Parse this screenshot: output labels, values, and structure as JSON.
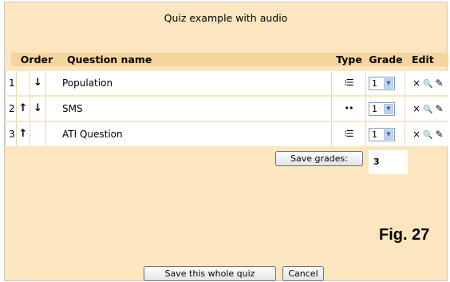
{
  "title": "Quiz example with audio",
  "table": {
    "headers": {
      "order": "Order",
      "question_name": "Question name",
      "type": "Type",
      "grade": "Grade",
      "edit": "Edit"
    },
    "rows": [
      {
        "num": "1",
        "up": "",
        "down": "↓",
        "name": "Population",
        "type_icon": "multichoice-icon",
        "type_glyph": "⁝☰",
        "grade": "1"
      },
      {
        "num": "2",
        "up": "↑",
        "down": "↓",
        "name": "SMS",
        "type_icon": "short-answer-icon",
        "type_glyph": "••",
        "grade": "1"
      },
      {
        "num": "3",
        "up": "↑",
        "down": "",
        "name": "ATI Question",
        "type_icon": "multichoice-icon",
        "type_glyph": "⁝☰",
        "grade": "1"
      }
    ],
    "edit_icons": {
      "delete": "×",
      "preview": "🔍",
      "edit": "✎"
    }
  },
  "save_grades_label": "Save grades:",
  "total_grade": "3",
  "figure_label": "Fig. 27",
  "buttons": {
    "save_quiz": "Save this whole quiz",
    "cancel": "Cancel"
  },
  "colors": {
    "background": "#fbe6bf",
    "header": "#f4d59c",
    "cell": "#ffffff"
  }
}
